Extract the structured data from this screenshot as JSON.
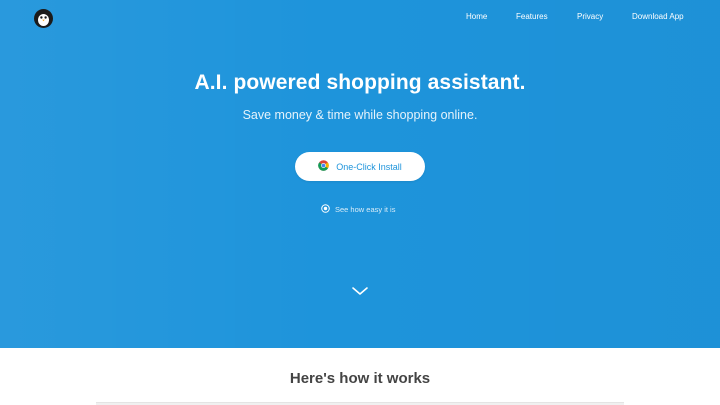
{
  "brand": {
    "logo_icon": "penguin-icon"
  },
  "nav": {
    "items": [
      {
        "label": "Home"
      },
      {
        "label": "Features"
      },
      {
        "label": "Privacy"
      },
      {
        "label": "Download App"
      }
    ]
  },
  "hero": {
    "headline": "A.I. powered shopping assistant.",
    "subheadline": "Save money & time while shopping online.",
    "install_button": {
      "label": "One-Click Install",
      "icon": "chrome-icon"
    },
    "video_link": {
      "label": "See how easy it is",
      "icon": "play-circle-icon"
    },
    "scroll_icon": "chevron-down-icon",
    "background_color": "#1e94db",
    "accent_color": "#1e94db"
  },
  "section": {
    "title": "Here's how it works"
  }
}
